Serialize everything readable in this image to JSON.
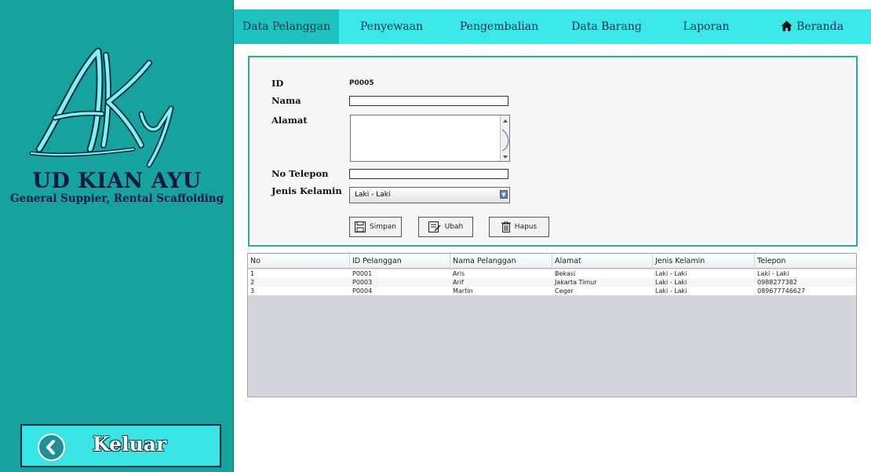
{
  "sidebar": {
    "company_name": "UD KIAN AYU",
    "tagline": "General Suppier, Rental Scaffolding",
    "logo_icon": "aky-logo",
    "exit_label": "Keluar"
  },
  "nav": {
    "tabs": [
      {
        "label": "Data Pelanggan",
        "active": true
      },
      {
        "label": "Penyewaan",
        "active": false
      },
      {
        "label": "Pengembalian",
        "active": false
      },
      {
        "label": "Data Barang",
        "active": false
      },
      {
        "label": "Laporan",
        "active": false
      }
    ],
    "home_label": "Beranda",
    "home_icon": "home-icon"
  },
  "form": {
    "id_label": "ID",
    "id_value": "P0005",
    "nama_label": "Nama",
    "nama_value": "",
    "alamat_label": "Alamat",
    "alamat_value": "",
    "telepon_label": "No Telepon",
    "telepon_value": "",
    "jk_label": "Jenis Kelamin",
    "jk_value": "Laki - Laki",
    "buttons": {
      "simpan": "Simpan",
      "ubah": "Ubah",
      "hapus": "Hapus"
    }
  },
  "table": {
    "columns": [
      "No",
      "ID Pelanggan",
      "Nama Pelanggan",
      "Alamat",
      "Jenis Kelamin",
      "Telepon"
    ],
    "rows": [
      [
        "1",
        "P0001",
        "Aris",
        "Bekasi",
        "Laki - Laki",
        "Laki - Laki"
      ],
      [
        "2",
        "P0003",
        "Arif",
        "Jakarta Timur",
        "Laki - Laki",
        "0988277382"
      ],
      [
        "3",
        "P0004",
        "Martin",
        "Ceger",
        "Laki - Laki",
        "089677746627"
      ]
    ]
  },
  "colors": {
    "sidebar_bg": "#16a3a0",
    "nav_bg": "#3ae7e9",
    "active_tab": "#1ec3c0",
    "exit_button": "#3be4e4"
  }
}
